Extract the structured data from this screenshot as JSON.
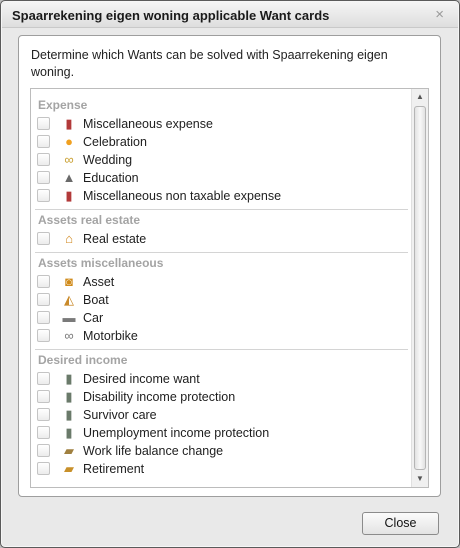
{
  "dialog": {
    "title": "Spaarrekening eigen woning applicable Want cards",
    "close_icon": "×",
    "intro": "Determine which Wants can be solved with Spaarrekening eigen woning.",
    "close_button": "Close"
  },
  "groups": [
    {
      "header": "Expense",
      "items": [
        {
          "label": "Miscellaneous expense",
          "icon": "expense-icon",
          "glyph": "▮",
          "color": "#b23a3a",
          "checked": false
        },
        {
          "label": "Celebration",
          "icon": "balloon-icon",
          "glyph": "●",
          "color": "#f0a020",
          "checked": false
        },
        {
          "label": "Wedding",
          "icon": "rings-icon",
          "glyph": "∞",
          "color": "#c9a032",
          "checked": false
        },
        {
          "label": "Education",
          "icon": "graduate-icon",
          "glyph": "▲",
          "color": "#6a6a6a",
          "checked": false
        },
        {
          "label": "Miscellaneous non taxable expense",
          "icon": "expense-icon",
          "glyph": "▮",
          "color": "#b23a3a",
          "checked": false
        }
      ]
    },
    {
      "header": "Assets real estate",
      "items": [
        {
          "label": "Real estate",
          "icon": "house-icon",
          "glyph": "⌂",
          "color": "#d0861a",
          "checked": false
        }
      ]
    },
    {
      "header": "Assets miscellaneous",
      "items": [
        {
          "label": "Asset",
          "icon": "asset-icon",
          "glyph": "◙",
          "color": "#d08a1a",
          "checked": false
        },
        {
          "label": "Boat",
          "icon": "boat-icon",
          "glyph": "◭",
          "color": "#c98a2a",
          "checked": false
        },
        {
          "label": "Car",
          "icon": "car-icon",
          "glyph": "▬",
          "color": "#7a7a7a",
          "checked": false
        },
        {
          "label": "Motorbike",
          "icon": "motorbike-icon",
          "glyph": "∞",
          "color": "#7a7a7a",
          "checked": false
        }
      ]
    },
    {
      "header": "Desired income",
      "items": [
        {
          "label": "Desired income want",
          "icon": "person-icon",
          "glyph": "▮",
          "color": "#6a7a6a",
          "checked": false
        },
        {
          "label": "Disability income protection",
          "icon": "person-icon",
          "glyph": "▮",
          "color": "#6a7a6a",
          "checked": false
        },
        {
          "label": "Survivor care",
          "icon": "person-icon",
          "glyph": "▮",
          "color": "#6a7a6a",
          "checked": false
        },
        {
          "label": "Unemployment income protection",
          "icon": "person-icon",
          "glyph": "▮",
          "color": "#6a7a6a",
          "checked": false
        },
        {
          "label": "Work life balance change",
          "icon": "work-life-icon",
          "glyph": "▰",
          "color": "#a08040",
          "checked": false
        },
        {
          "label": "Retirement",
          "icon": "retirement-icon",
          "glyph": "▰",
          "color": "#c8902a",
          "checked": false
        }
      ]
    }
  ],
  "scrollbar": {
    "up": "▲",
    "down": "▼"
  }
}
